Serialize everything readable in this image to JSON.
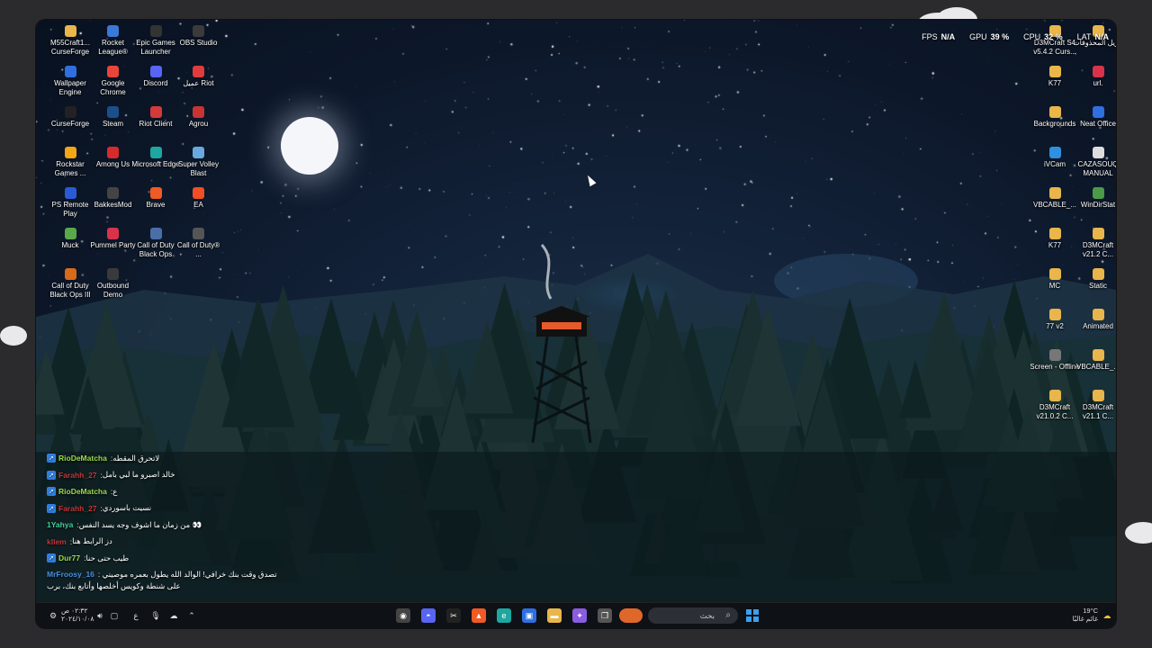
{
  "overlay": {
    "fps_label": "FPS",
    "fps_value": "N/A",
    "gpu_label": "GPU",
    "gpu_value": "39 %",
    "cpu_label": "CPU",
    "cpu_value": "32 %",
    "lat_label": "LAT",
    "lat_value": "N/A"
  },
  "desktop_icons_left": [
    {
      "label": "M55Craft1... CurseForge",
      "icon": "folder-icon",
      "color": "#e8b64a"
    },
    {
      "label": "Rocket League®",
      "icon": "rocket-league-icon",
      "color": "#3a79d8"
    },
    {
      "label": "Epic Games Launcher",
      "icon": "epic-games-icon",
      "color": "#333333"
    },
    {
      "label": "OBS Studio",
      "icon": "obs-icon",
      "color": "#3b3b3b"
    },
    {
      "label": "Wallpaper Engine",
      "icon": "wallpaper-engine-icon",
      "color": "#2f6fe0"
    },
    {
      "label": "Google Chrome",
      "icon": "chrome-icon",
      "color": "#e9453a"
    },
    {
      "label": "Discord",
      "icon": "discord-icon",
      "color": "#5865f2"
    },
    {
      "label": "عميل Riot",
      "icon": "riot-icon",
      "color": "#e23b3b"
    },
    {
      "label": "CurseForge",
      "icon": "curseforge-icon",
      "color": "#222222"
    },
    {
      "label": "Steam",
      "icon": "steam-icon",
      "color": "#1b4f8a"
    },
    {
      "label": "Riot Client",
      "icon": "riot-client-icon",
      "color": "#d43a3a"
    },
    {
      "label": "Agrou",
      "icon": "agrou-icon",
      "color": "#c83333"
    },
    {
      "label": "Rockstar Games ...",
      "icon": "rockstar-icon",
      "color": "#f2a516"
    },
    {
      "label": "Among Us",
      "icon": "among-us-icon",
      "color": "#d62b2b"
    },
    {
      "label": "Microsoft Edge",
      "icon": "edge-icon",
      "color": "#1ea6a0"
    },
    {
      "label": "Super Volley Blast",
      "icon": "volley-icon",
      "color": "#6aa8e0"
    },
    {
      "label": "PS Remote Play",
      "icon": "ps-remote-icon",
      "color": "#2a5bd7"
    },
    {
      "label": "BakkesMod",
      "icon": "bakkesmod-icon",
      "color": "#444444"
    },
    {
      "label": "Brave",
      "icon": "brave-icon",
      "color": "#f05a24"
    },
    {
      "label": "EA",
      "icon": "ea-icon",
      "color": "#f04e23"
    },
    {
      "label": "Muck",
      "icon": "muck-icon",
      "color": "#5aa84a"
    },
    {
      "label": "Pummel Party",
      "icon": "pummel-party-icon",
      "color": "#d8334a"
    },
    {
      "label": "Call of Duty Black Ops",
      "icon": "cod-icon",
      "color": "#4a6ea8"
    },
    {
      "label": "Call of Duty® ...",
      "icon": "cod2-icon",
      "color": "#555555"
    },
    {
      "label": "Call of Duty Black Ops III",
      "icon": "cod3-icon",
      "color": "#d86a1a"
    },
    {
      "label": "Outbound Demo",
      "icon": "outbound-icon",
      "color": "#3a3a3a"
    }
  ],
  "desktop_icons_right": [
    {
      "label": "D3MCraft S4 v5.4.2 Curs...",
      "icon": "folder-icon",
      "color": "#e8b64a"
    },
    {
      "label": "تنزيل المحذوفات",
      "icon": "folder-icon",
      "color": "#e8b64a"
    },
    {
      "label": "K77",
      "icon": "folder-icon",
      "color": "#e8b64a"
    },
    {
      "label": "url.",
      "icon": "url-icon",
      "color": "#d8334a"
    },
    {
      "label": "Backgrounds",
      "icon": "folder-icon",
      "color": "#e8b64a"
    },
    {
      "label": "Neat Office",
      "icon": "neat-office-icon",
      "color": "#2f6fe0"
    },
    {
      "label": "iVCam",
      "icon": "ivcam-icon",
      "color": "#2f8fe0"
    },
    {
      "label": "CAZASOUQ MANUAL",
      "icon": "document-icon",
      "color": "#dddddd"
    },
    {
      "label": "VBCABLE_...",
      "icon": "folder-icon",
      "color": "#e8b64a"
    },
    {
      "label": "WinDirStat",
      "icon": "windirstat-icon",
      "color": "#4a9a4a"
    },
    {
      "label": "K77",
      "icon": "folder-icon",
      "color": "#e8b64a"
    },
    {
      "label": "D3MCraft v21.2 C...",
      "icon": "folder-icon",
      "color": "#e8b64a"
    },
    {
      "label": "MC",
      "icon": "folder-icon",
      "color": "#e8b64a"
    },
    {
      "label": "Static",
      "icon": "folder-icon",
      "color": "#e8b64a"
    },
    {
      "label": "77 v2",
      "icon": "folder-icon",
      "color": "#e8b64a"
    },
    {
      "label": "Animated",
      "icon": "folder-icon",
      "color": "#e8b64a"
    },
    {
      "label": "Screen - Offline",
      "icon": "image-icon",
      "color": "#777777"
    },
    {
      "label": "VBCABLE_...",
      "icon": "folder-icon",
      "color": "#e8b64a"
    },
    {
      "label": "D3MCraft v21.0.2 C...",
      "icon": "folder-icon",
      "color": "#e8b64a"
    },
    {
      "label": "D3MCraft v21.1 C...",
      "icon": "folder-icon",
      "color": "#e8b64a"
    }
  ],
  "chat": [
    {
      "user": "RioDeMatcha",
      "color": "#9bd94a",
      "text": "لاتحرق المقطه",
      "badge": true
    },
    {
      "user": "Farahh_27",
      "color": "#c0363a",
      "text": "خالد اصبرو ما لبي بامل",
      "badge": true
    },
    {
      "user": "RioDeMatcha",
      "color": "#9bd94a",
      "text": "ع",
      "badge": true
    },
    {
      "user": "Farahh_27",
      "color": "#c0363a",
      "text": "نسيت باسوردي",
      "badge": true
    },
    {
      "user": "1Yahya",
      "color": "#3fcf9a",
      "text": "من زمان ما اشوف وجه يسد النفس 👀",
      "badge": false
    },
    {
      "user": "kllem",
      "color": "#c0363a",
      "text": "دز الرابط هنا",
      "badge": false
    },
    {
      "user": "Dur77",
      "color": "#9bd94a",
      "text": "طيب حتى حنا",
      "badge": true
    },
    {
      "user": "MrFroosy_16",
      "color": "#4a8fe0",
      "text": "تصدق وقت بنك خرافي! الوالد الله يطول بعمره موصيني على شنطة وكويس أخلصها وأتابع بنك، برب",
      "badge": false
    }
  ],
  "taskbar": {
    "search_placeholder": "بحث",
    "time": "٠٢:٣٢ ص",
    "date": "٢٠٢٤/١٠/٠٨",
    "lang": "ع",
    "weather_temp": "19°C",
    "weather_desc": "غائم غالبًا",
    "apps": [
      {
        "name": "obs-taskbar-icon",
        "color": "#444444",
        "glyph": "◉"
      },
      {
        "name": "discord-taskbar-icon",
        "color": "#5865f2",
        "glyph": "◓"
      },
      {
        "name": "capcut-taskbar-icon",
        "color": "#222222",
        "glyph": "✂"
      },
      {
        "name": "brave-taskbar-icon",
        "color": "#f05a24",
        "glyph": "▲"
      },
      {
        "name": "edge-taskbar-icon",
        "color": "#1ea6a0",
        "glyph": "e"
      },
      {
        "name": "store-taskbar-icon",
        "color": "#2f6fe0",
        "glyph": "▣"
      },
      {
        "name": "explorer-taskbar-icon",
        "color": "#e8b64a",
        "glyph": "▬"
      },
      {
        "name": "copilot-taskbar-icon",
        "color": "#8a5ce0",
        "glyph": "✦"
      },
      {
        "name": "taskview-taskbar-icon",
        "color": "#555555",
        "glyph": "❐"
      }
    ]
  }
}
